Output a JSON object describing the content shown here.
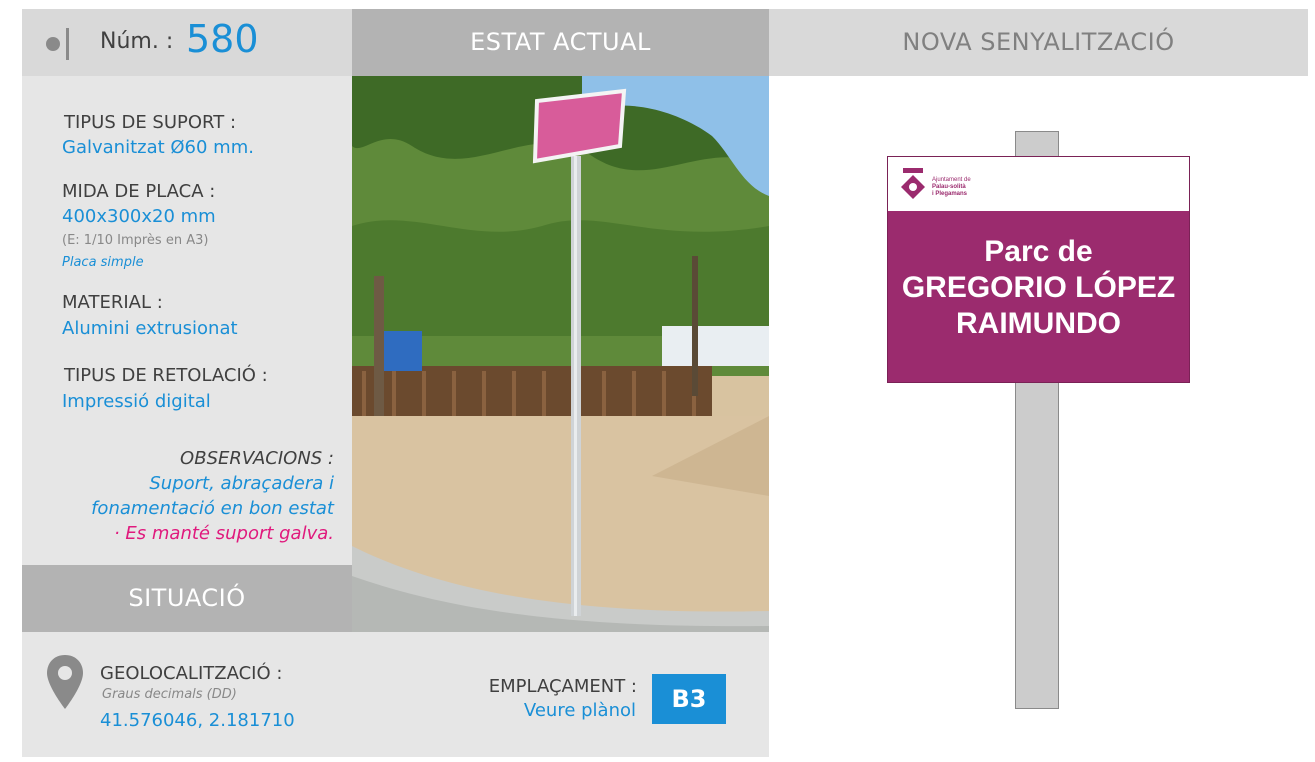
{
  "header": {
    "num_label": "Núm. :",
    "num_value": "580",
    "estat_title": "ESTAT ACTUAL",
    "nova_title": "NOVA SENYALITZACIÓ"
  },
  "specs": {
    "suport_label": "TIPUS DE SUPORT :",
    "suport_value": "Galvanitzat Ø60 mm.",
    "mida_label": "MIDA DE PLACA :",
    "mida_value": "400x300x20 mm",
    "mida_scale": "(E: 1/10 Imprès en A3)",
    "mida_type": "Placa simple",
    "material_label": "MATERIAL :",
    "material_value": "Alumini extrusionat",
    "retolacio_label": "TIPUS DE RETOLACIÓ :",
    "retolacio_value": "Impressió digital"
  },
  "observacions": {
    "label": "OBSERVACIONS :",
    "line1": "Suport, abraçadera i",
    "line2": "fonamentació en bon estat",
    "line3": "· Es manté suport galva."
  },
  "situacio": {
    "title": "SITUACIÓ",
    "geo_label": "GEOLOCALITZACIÓ :",
    "geo_format": "Graus decimals (DD)",
    "geo_value": "41.576046, 2.181710",
    "empl_label": "EMPLAÇAMENT :",
    "empl_link": "Veure plànol",
    "empl_code": "B3"
  },
  "sign": {
    "logo_line1": "Ajuntament de",
    "logo_line2": "Palau-solità",
    "logo_line3": "i Plegamans",
    "line1": "Parc de",
    "line2": "GREGORIO LÓPEZ",
    "line3": "RAIMUNDO"
  },
  "colors": {
    "accent_blue": "#1a8fd6",
    "magenta": "#e0197d",
    "sign_purple": "#9b2b6e"
  },
  "icons": [
    "record-icon",
    "location-pin-icon",
    "municipal-logo-icon"
  ]
}
